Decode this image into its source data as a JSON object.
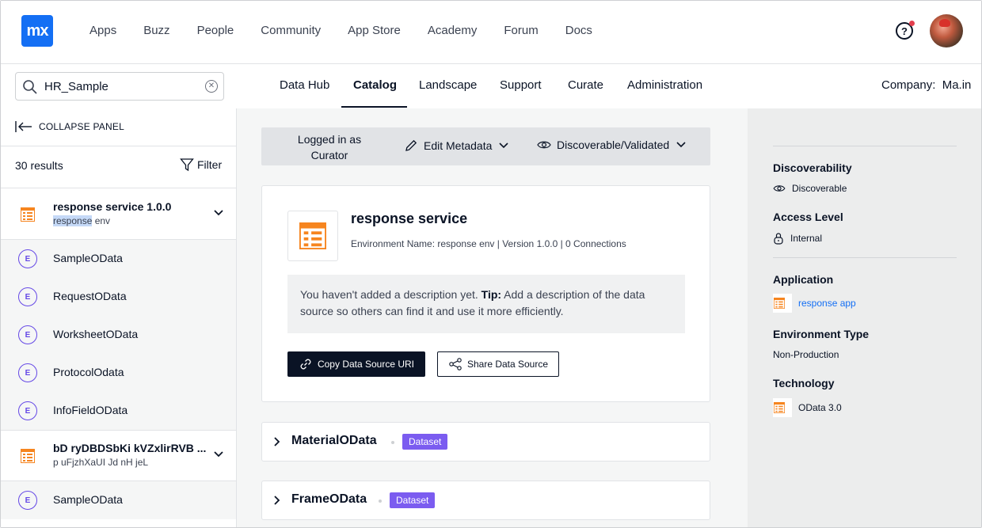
{
  "topnav": {
    "logo": "mx",
    "links": [
      "Apps",
      "Buzz",
      "People",
      "Community",
      "App Store",
      "Academy",
      "Forum",
      "Docs"
    ],
    "help": "?"
  },
  "search": {
    "value": "HR_Sample",
    "placeholder": ""
  },
  "subnav": {
    "tabs": [
      "Data Hub",
      "Catalog",
      "Landscape",
      "Support",
      "Curate",
      "Administration"
    ],
    "active": "Catalog",
    "company_label": "Company:",
    "company_value": "Ma.in"
  },
  "left": {
    "collapse_label": "COLLAPSE PANEL",
    "results": "30 results",
    "filter_label": "Filter",
    "services": [
      {
        "title": "response service 1.0.0",
        "sub_highlight": "response",
        "sub_rest": " env"
      },
      {
        "title": "bD ryDBDSbKi kVZxlirRVB ...",
        "sub_highlight": "",
        "sub_rest": "p uFjzhXaUI Jd nH jeL"
      }
    ],
    "entity_badge": "E",
    "entities_1": [
      "SampleOData",
      "RequestOData",
      "WorksheetOData",
      "ProtocolOdata",
      "InfoFieldOData"
    ],
    "entities_2": [
      "SampleOData"
    ]
  },
  "actionbar": {
    "logged_in": "Logged in as Curator",
    "edit_metadata": "Edit Metadata",
    "discoverable": "Discoverable/Validated"
  },
  "card": {
    "title": "response service",
    "meta": "Environment Name: response env | Version 1.0.0 | 0 Connections",
    "desc_pre": "You haven't added a description yet. ",
    "desc_tip": "Tip:",
    "desc_post": " Add a description of the data source so others can find it and use it more efficiently.",
    "copy_button": "Copy Data Source URI",
    "share_button": "Share Data Source"
  },
  "datasets": [
    {
      "name": "MaterialOData",
      "tag": "Dataset"
    },
    {
      "name": "FrameOData",
      "tag": "Dataset"
    }
  ],
  "right": {
    "discoverability_label": "Discoverability",
    "discoverability_value": "Discoverable",
    "access_label": "Access Level",
    "access_value": "Internal",
    "application_label": "Application",
    "application_value": "response app",
    "env_type_label": "Environment Type",
    "env_type_value": "Non-Production",
    "technology_label": "Technology",
    "technology_value": "OData 3.0"
  },
  "colors": {
    "accent": "#146ff4",
    "dark": "#0a1325",
    "entity": "#6548e6",
    "dataset_tag": "#7b5cf0",
    "service_icon": "#f6851f"
  }
}
